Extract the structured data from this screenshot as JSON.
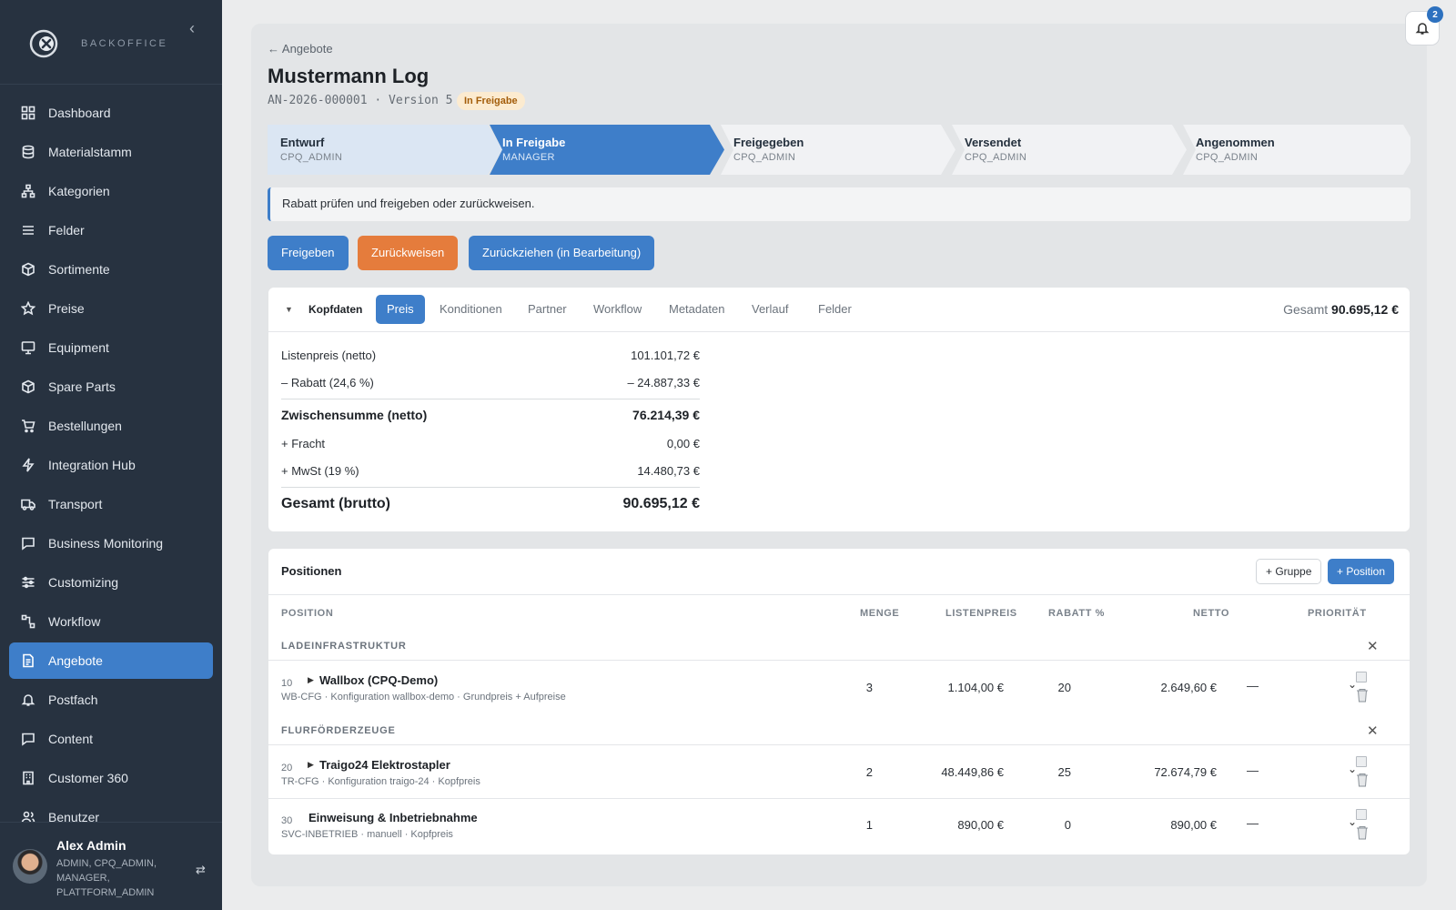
{
  "brand": {
    "name": "BACKOFFICE"
  },
  "nav": [
    {
      "label": "Dashboard",
      "icon": "grid-icon"
    },
    {
      "label": "Materialstamm",
      "icon": "database-icon"
    },
    {
      "label": "Kategorien",
      "icon": "hierarchy-icon"
    },
    {
      "label": "Felder",
      "icon": "list-icon"
    },
    {
      "label": "Sortimente",
      "icon": "box-icon"
    },
    {
      "label": "Preise",
      "icon": "star-icon"
    },
    {
      "label": "Equipment",
      "icon": "monitor-icon"
    },
    {
      "label": "Spare Parts",
      "icon": "cube-icon"
    },
    {
      "label": "Bestellungen",
      "icon": "cart-icon"
    },
    {
      "label": "Integration Hub",
      "icon": "bolt-icon"
    },
    {
      "label": "Transport",
      "icon": "truck-icon"
    },
    {
      "label": "Business Monitoring",
      "icon": "chat-icon"
    },
    {
      "label": "Customizing",
      "icon": "sliders-icon"
    },
    {
      "label": "Workflow",
      "icon": "workflow-icon"
    },
    {
      "label": "Angebote",
      "icon": "document-icon",
      "active": true
    },
    {
      "label": "Postfach",
      "icon": "bell-icon"
    },
    {
      "label": "Content",
      "icon": "message-icon"
    },
    {
      "label": "Customer 360",
      "icon": "building-icon"
    },
    {
      "label": "Benutzer",
      "icon": "users-icon"
    }
  ],
  "user": {
    "name": "Alex Admin",
    "roles": "ADMIN, CPQ_ADMIN, MANAGER, PLATTFORM_ADMIN"
  },
  "notifications": {
    "count": "2"
  },
  "page": {
    "back": "← Angebote",
    "title": "Mustermann Log",
    "subline": "AN-2026-000001 · Version 5",
    "status": "In Freigabe"
  },
  "steps": [
    {
      "name": "Entwurf",
      "role": "CPQ_ADMIN"
    },
    {
      "name": "In Freigabe",
      "role": "MANAGER"
    },
    {
      "name": "Freigegeben",
      "role": "CPQ_ADMIN"
    },
    {
      "name": "Versendet",
      "role": "CPQ_ADMIN"
    },
    {
      "name": "Angenommen",
      "role": "CPQ_ADMIN"
    }
  ],
  "info": "Rabatt prüfen und freigeben oder zurückweisen.",
  "actions": {
    "approve": "Freigeben",
    "reject": "Zurückweisen",
    "withdraw": "Zurückziehen (in Bearbeitung)"
  },
  "tabs": {
    "head": "Kopfdaten",
    "items": [
      "Preis",
      "Konditionen",
      "Partner",
      "Workflow",
      "Metadaten",
      "Verlauf",
      "Felder"
    ],
    "total_label": "Gesamt",
    "total_value": "90.695,12 €"
  },
  "price": {
    "list_label": "Listenpreis (netto)",
    "list_value": "101.101,72 €",
    "discount_label": "– Rabatt (24,6 %)",
    "discount_value": "– 24.887,33 €",
    "subtotal_label": "Zwischensumme (netto)",
    "subtotal_value": "76.214,39 €",
    "freight_label": "+ Fracht",
    "freight_value": "0,00 €",
    "vat_label": "+ MwSt (19 %)",
    "vat_value": "14.480,73 €",
    "gross_label": "Gesamt (brutto)",
    "gross_value": "90.695,12 €"
  },
  "positions": {
    "title": "Positionen",
    "add_group": "+ Gruppe",
    "add_position": "+ Position",
    "columns": {
      "position": "POSITION",
      "qty": "MENGE",
      "list": "LISTENPREIS",
      "discount": "RABATT %",
      "net": "NETTO",
      "priority": "PRIORITÄT"
    },
    "groups": [
      {
        "label": "LADEINFRASTRUKTUR"
      },
      {
        "label": "FLURFÖRDERZEUGE"
      }
    ],
    "rows": [
      {
        "no": "10",
        "name": "Wallbox (CPQ-Demo)",
        "sub": "WB-CFG · Konfiguration wallbox-demo · Grundpreis + Aufpreise",
        "qty": "3",
        "list": "1.104,00 €",
        "discount": "20",
        "net": "2.649,60 €",
        "priority": "—"
      },
      {
        "no": "20",
        "name": "Traigo24 Elektrostapler",
        "sub": "TR-CFG · Konfiguration traigo-24 · Kopfpreis",
        "qty": "2",
        "list": "48.449,86 €",
        "discount": "25",
        "net": "72.674,79 €",
        "priority": "—"
      },
      {
        "no": "30",
        "name": "Einweisung & Inbetriebnahme",
        "sub": "SVC-INBETRIEB · manuell · Kopfpreis",
        "qty": "1",
        "list": "890,00 €",
        "discount": "0",
        "net": "890,00 €",
        "priority": "—"
      }
    ]
  }
}
